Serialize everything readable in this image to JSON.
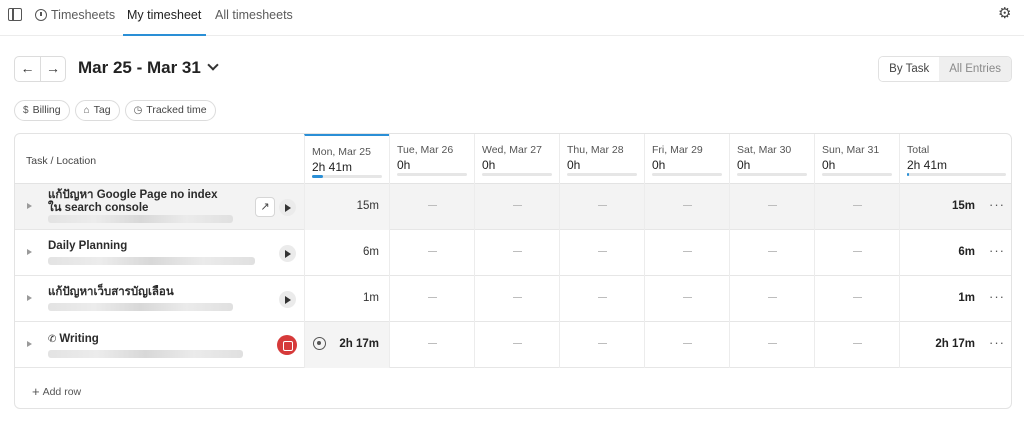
{
  "topbar": {
    "tabs": [
      {
        "label": "Timesheets",
        "icon": "timer-icon"
      },
      {
        "label": "My timesheet",
        "active": true
      },
      {
        "label": "All timesheets"
      }
    ],
    "settings_icon": "gear-icon"
  },
  "header": {
    "prev_label": "←",
    "next_label": "→",
    "date_range": "Mar 25 - Mar 31",
    "view_toggle": [
      "By Task",
      "All Entries"
    ],
    "selected_view": "All Entries"
  },
  "filters": [
    {
      "label": "Billing",
      "icon": "dollar-icon"
    },
    {
      "label": "Tag",
      "icon": "tag-icon"
    },
    {
      "label": "Tracked time",
      "icon": "clock-icon"
    }
  ],
  "table": {
    "task_header": "Task / Location",
    "days": [
      {
        "label": "Mon, Mar 25",
        "hours": "2h 41m",
        "progress": 0.15
      },
      {
        "label": "Tue, Mar 26",
        "hours": "0h",
        "progress": 0
      },
      {
        "label": "Wed, Mar 27",
        "hours": "0h",
        "progress": 0
      },
      {
        "label": "Thu, Mar 28",
        "hours": "0h",
        "progress": 0
      },
      {
        "label": "Fri, Mar 29",
        "hours": "0h",
        "progress": 0
      },
      {
        "label": "Sat, Mar 30",
        "hours": "0h",
        "progress": 0
      },
      {
        "label": "Sun, Mar 31",
        "hours": "0h",
        "progress": 0
      }
    ],
    "total": {
      "label": "Total",
      "hours": "2h 41m",
      "progress": 0.02
    },
    "rows": [
      {
        "title": "แก้ปัญหา Google Page no index ใน search console",
        "mon": "15m",
        "total": "15m",
        "running": false
      },
      {
        "title": "Daily Planning",
        "mon": "6m",
        "total": "6m",
        "running": false
      },
      {
        "title": "แก้ปัญหาเว็บสารบัญเลือน",
        "mon": "1m",
        "total": "1m",
        "running": false
      },
      {
        "title": "Writing",
        "mon": "2h 17m",
        "total": "2h 17m",
        "running": true
      }
    ],
    "empty_cell": "—",
    "add_row": "Add row"
  },
  "colors": {
    "accent": "#2a8fd6",
    "stop": "#d63a3a"
  }
}
